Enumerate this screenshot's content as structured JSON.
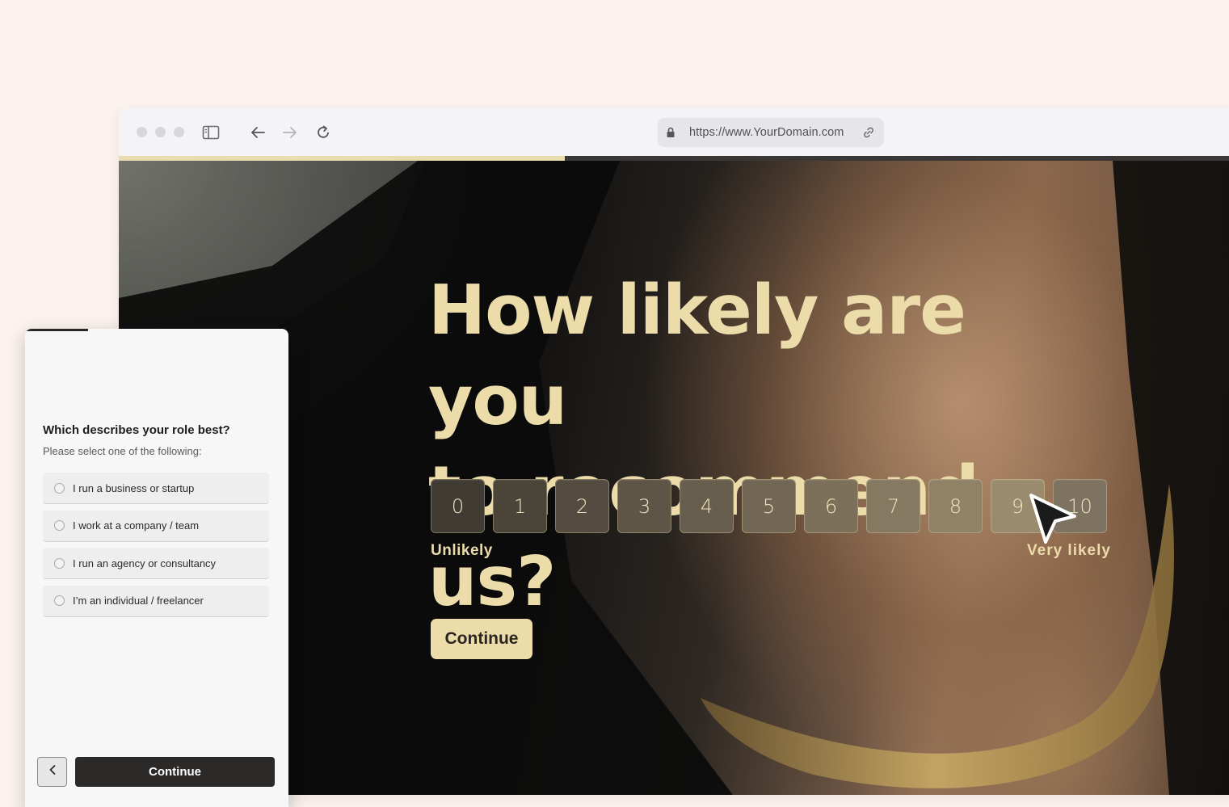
{
  "browser": {
    "url": "https://www.YourDomain.com",
    "progress_percent": 40
  },
  "survey": {
    "question_line1": "How likely are you",
    "question_line2": "to recommend us?",
    "scale": [
      "0",
      "1",
      "2",
      "3",
      "4",
      "5",
      "6",
      "7",
      "8",
      "9",
      "10"
    ],
    "scale_colors": [
      "#403b33",
      "#4a4439",
      "#544c40",
      "#5e5547",
      "#685e4d",
      "#726754",
      "#7c705a",
      "#867961",
      "#908267",
      "#9a8b6e",
      "#7e7260"
    ],
    "low_label": "Unlikely",
    "high_label": "Very likely",
    "continue_label": "Continue",
    "accent_color": "#ebdcaa"
  },
  "panel": {
    "title": "Which describes your role best?",
    "subtitle": "Please select one of the following:",
    "options": [
      "I run a business or startup",
      "I work at a company / team",
      "I run an agency or consultancy",
      "I’m an individual / freelancer"
    ],
    "continue_label": "Continue"
  }
}
